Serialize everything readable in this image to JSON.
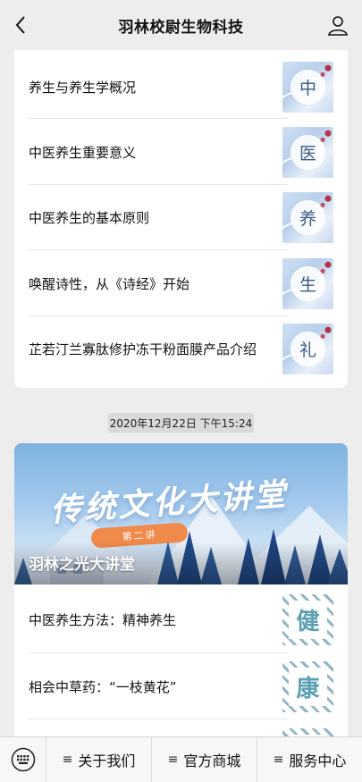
{
  "header": {
    "title": "羽林校尉生物科技",
    "back_icon": "chevron-left-icon",
    "profile_icon": "user-icon"
  },
  "article_list_1": [
    {
      "title": "养生与养生学概况",
      "thumb_char": "中"
    },
    {
      "title": "中医养生重要意义",
      "thumb_char": "医"
    },
    {
      "title": "中医养生的基本原则",
      "thumb_char": "养"
    },
    {
      "title": "唤醒诗性，从《诗经》开始",
      "thumb_char": "生"
    },
    {
      "title": "芷若汀兰寡肽修护冻干粉面膜产品介绍",
      "thumb_char": "礼"
    }
  ],
  "timestamp": "2020年12月22日 下午15:24",
  "feature": {
    "banner_title": "传统文化大讲堂",
    "banner_badge": "第二讲",
    "caption": "羽林之光大讲堂",
    "items": [
      {
        "title": "中医养生方法：精神养生",
        "thumb_char": "健"
      },
      {
        "title": "相会中草药：“一枝黄花”",
        "thumb_char": "康"
      }
    ]
  },
  "bottom_menu": {
    "keyboard_icon": "keyboard-icon",
    "items": [
      "关于我们",
      "官方商城",
      "服务中心"
    ],
    "menu_marker": "≡"
  },
  "colors": {
    "background": "#ededed",
    "accent_orange": "#f08a4a",
    "thumb_text": "#3a5a82",
    "pattern_text": "#5b9fb2"
  }
}
